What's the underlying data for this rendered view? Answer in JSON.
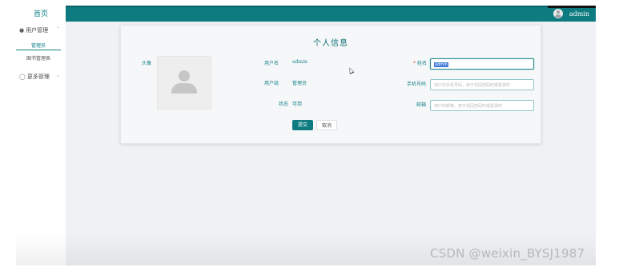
{
  "sidebar": {
    "home_label": "首页",
    "groups": [
      {
        "label": "用户管理",
        "icon": "user-icon",
        "expanded": true,
        "items": [
          {
            "label": "管理员",
            "active": true
          },
          {
            "label": "图书管理表",
            "active": false
          }
        ]
      },
      {
        "label": "更多管理",
        "icon": "grid-icon",
        "expanded": false,
        "items": []
      }
    ]
  },
  "header": {
    "username": "admin",
    "accent_color": "#0d7b80"
  },
  "profile": {
    "title": "个人信息",
    "avatar_label": "头像",
    "username_label": "用户名",
    "username_value": "admin",
    "usergroup_label": "用户组",
    "usergroup_value": "管理员",
    "status_label": "状态",
    "status_value": "可用",
    "name_label": "姓名",
    "name_value": "admin",
    "phone_label": "手机号码",
    "phone_placeholder": "用户的手机号码，用于找回密码时或登录时",
    "email_label": "邮箱",
    "email_placeholder": "用户的邮箱，用于找回密码时或登录时",
    "submit_label": "提交",
    "cancel_label": "取消"
  },
  "watermark": "CSDN @weixin_BYSJ1987"
}
